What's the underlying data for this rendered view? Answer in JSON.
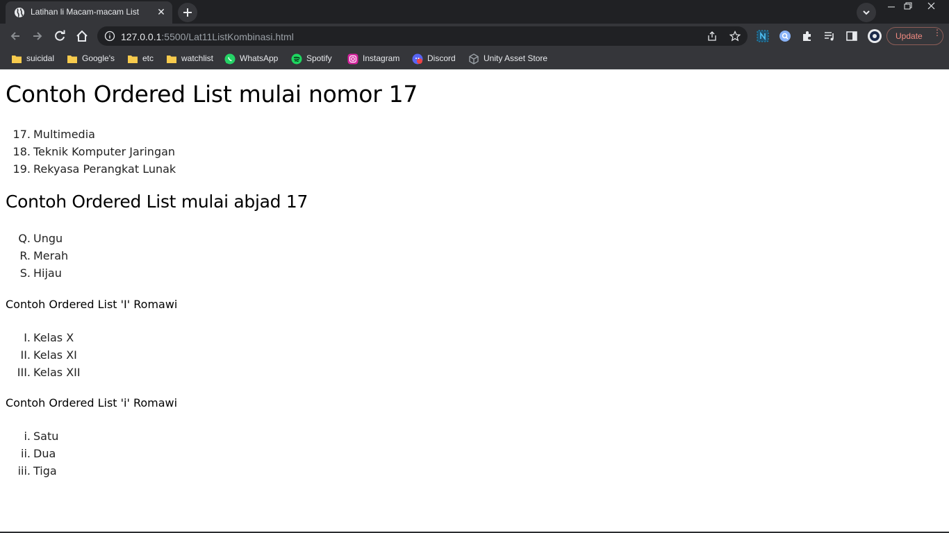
{
  "browser": {
    "tab": {
      "title": "Latihan li Macam-macam List",
      "close": "✕"
    },
    "address": {
      "host": "127.0.0.1",
      "path": ":5500/Lat11ListKombinasi.html"
    },
    "update_label": "Update",
    "bookmarks": [
      {
        "label": "suicidal",
        "icon": "folder-icon"
      },
      {
        "label": "Google's",
        "icon": "folder-icon"
      },
      {
        "label": "etc",
        "icon": "folder-icon"
      },
      {
        "label": "watchlist",
        "icon": "folder-icon"
      },
      {
        "label": "WhatsApp",
        "icon": "whatsapp-icon"
      },
      {
        "label": "Spotify",
        "icon": "spotify-icon"
      },
      {
        "label": "Instagram",
        "icon": "instagram-icon"
      },
      {
        "label": "Discord",
        "icon": "discord-icon"
      },
      {
        "label": "Unity Asset Store",
        "icon": "unity-icon"
      }
    ],
    "colors": {
      "frame": "#202124",
      "toolbar": "#35363a",
      "text": "#e8eaed",
      "update": "#f28b82"
    }
  },
  "page": {
    "heading1": "Contoh Ordered List mulai nomor 17",
    "list1": [
      {
        "marker": "17.",
        "text": "Multimedia"
      },
      {
        "marker": "18.",
        "text": "Teknik Komputer Jaringan"
      },
      {
        "marker": "19.",
        "text": "Rekyasa Perangkat Lunak"
      }
    ],
    "heading2": "Contoh Ordered List mulai abjad 17",
    "list2": [
      {
        "marker": "Q.",
        "text": "Ungu"
      },
      {
        "marker": "R.",
        "text": "Merah"
      },
      {
        "marker": "S.",
        "text": "Hijau"
      }
    ],
    "heading3": "Contoh Ordered List 'I' Romawi",
    "list3": [
      {
        "marker": "I.",
        "text": "Kelas X"
      },
      {
        "marker": "II.",
        "text": "Kelas XI"
      },
      {
        "marker": "III.",
        "text": "Kelas XII"
      }
    ],
    "heading4": "Contoh Ordered List 'i' Romawi",
    "list4": [
      {
        "marker": "i.",
        "text": "Satu"
      },
      {
        "marker": "ii.",
        "text": "Dua"
      },
      {
        "marker": "iii.",
        "text": "Tiga"
      }
    ]
  }
}
